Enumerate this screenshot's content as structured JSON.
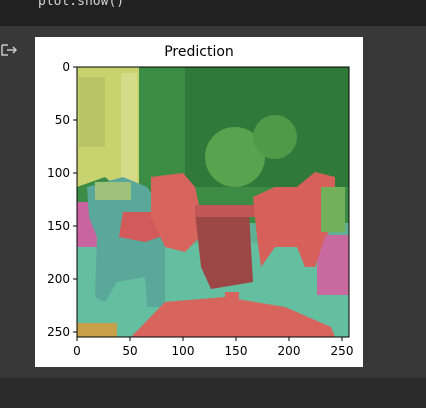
{
  "notebook": {
    "code_line": "plot.show()",
    "output_icon": "output-redirect-icon"
  },
  "figure": {
    "title": "Prediction",
    "x_ticks": [
      "0",
      "50",
      "100",
      "150",
      "200",
      "250"
    ],
    "y_ticks": [
      "0",
      "50",
      "100",
      "150",
      "200",
      "250"
    ],
    "segmentation_colors": {
      "yellow": "#c8d26e",
      "green": "#3c8c46",
      "red": "#d25a5a",
      "teal": "#64bea0",
      "magenta": "#c864a0",
      "brown": "#9c4646"
    }
  }
}
